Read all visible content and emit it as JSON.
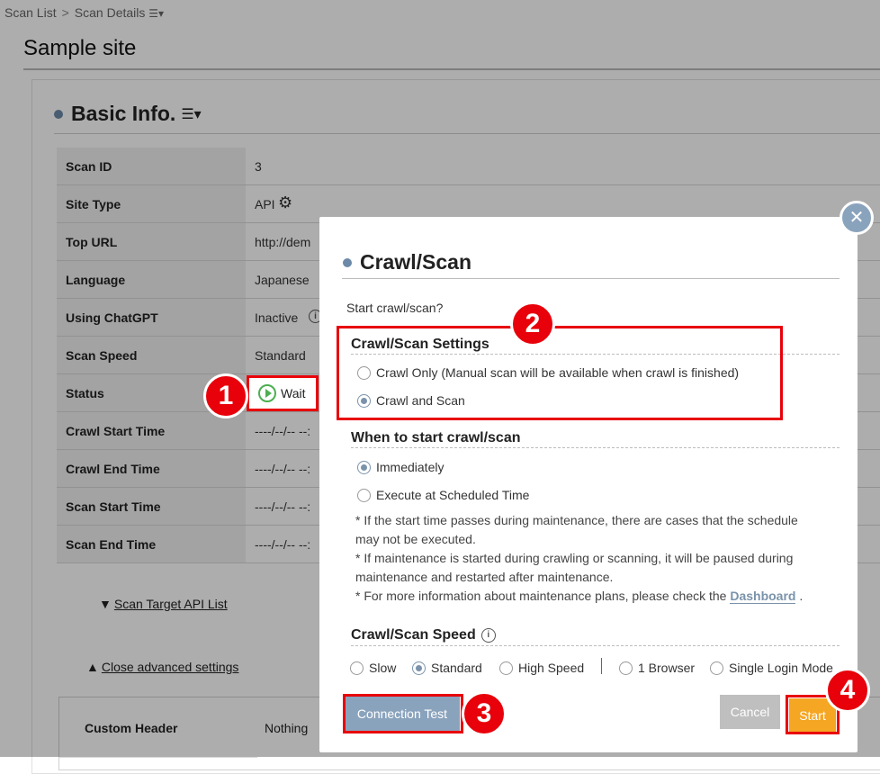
{
  "breadcrumb": {
    "item1": "Scan List",
    "item2": "Scan Details",
    "menu_icon": "list-menu-icon"
  },
  "page_title": "Sample site",
  "basic_info": {
    "title": "Basic Info.",
    "rows": [
      {
        "label": "Scan ID",
        "value": "3"
      },
      {
        "label": "Site Type",
        "value": "API"
      },
      {
        "label": "Top URL",
        "value": "http://dem"
      },
      {
        "label": "Language",
        "value": "Japanese"
      },
      {
        "label": "Using ChatGPT",
        "value": "Inactive"
      },
      {
        "label": "Scan Speed",
        "value": "Standard"
      },
      {
        "label": "Status",
        "value": "Wait"
      },
      {
        "label": "Crawl Start Time",
        "value": "----/--/-- --:"
      },
      {
        "label": "Crawl End Time",
        "value": "----/--/-- --:"
      },
      {
        "label": "Scan Start Time",
        "value": "----/--/-- --:"
      },
      {
        "label": "Scan End Time",
        "value": "----/--/-- --:"
      }
    ],
    "scan_target_link": "Scan Target API List",
    "close_advanced_link": "Close advanced settings",
    "custom_header_label": "Custom Header",
    "custom_header_value": "Nothing"
  },
  "modal": {
    "title": "Crawl/Scan",
    "prompt": "Start crawl/scan?",
    "settings_heading": "Crawl/Scan Settings",
    "settings_options": [
      "Crawl Only (Manual scan will be available when crawl is finished)",
      "Crawl and Scan"
    ],
    "settings_selected": "Crawl and Scan",
    "when_heading": "When to start crawl/scan",
    "when_options": [
      "Immediately",
      "Execute at Scheduled Time"
    ],
    "when_selected": "Immediately",
    "notes": [
      "* If the start time passes during maintenance, there are cases that the schedule may not be executed.",
      "* If maintenance is started during crawling or scanning, it will be paused during maintenance and restarted after maintenance."
    ],
    "note3_prefix": "* For more information about maintenance plans, please check the",
    "note3_link": "Dashboard",
    "note3_suffix": ".",
    "speed_heading": "Crawl/Scan Speed",
    "speed_options": [
      "Slow",
      "Standard",
      "High Speed"
    ],
    "speed_selected": "Standard",
    "mode_options": [
      "1 Browser",
      "Single Login Mode"
    ],
    "buttons": {
      "test": "Connection Test",
      "cancel": "Cancel",
      "start": "Start"
    }
  },
  "annotations": [
    "1",
    "2",
    "3",
    "4"
  ],
  "colors": {
    "accent": "#8aa3bd",
    "start": "#f5a623",
    "annotation": "#e8000a",
    "play": "#4caf50"
  }
}
